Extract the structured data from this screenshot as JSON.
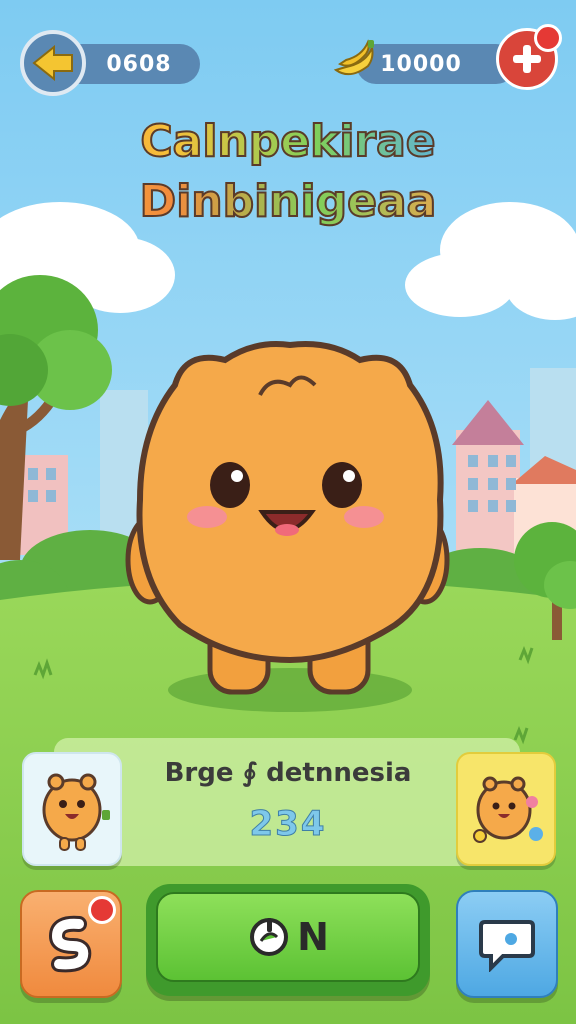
{
  "header": {
    "left_counter": "0608",
    "right_counter": "10000",
    "back_icon": "arrow-left-icon",
    "currency_icon": "banana-icon",
    "add_icon": "plus-icon"
  },
  "title": {
    "line1": "Calnpekirae",
    "line2": "Dinbinigeaa"
  },
  "info_panel": {
    "title": "Brge ∮ detnnesia",
    "count": "234"
  },
  "controls": {
    "main_label": "N",
    "main_icon": "power-icon",
    "left_icon": "snake-icon",
    "right_icon": "chat-bubble-icon"
  },
  "colors": {
    "sky": "#8fd3f4",
    "grass": "#8ed14d",
    "character": "#f5a94a",
    "accent_red": "#e53935"
  }
}
